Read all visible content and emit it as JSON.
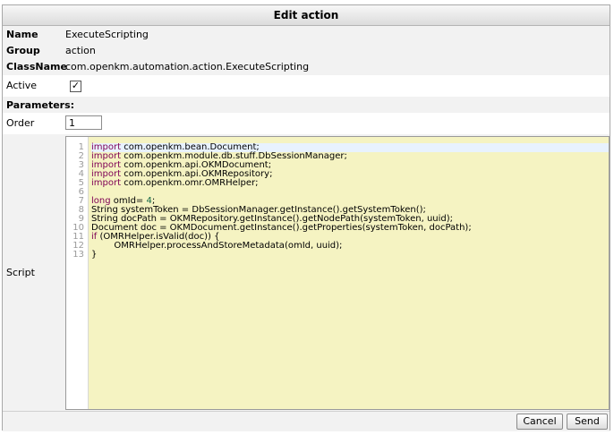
{
  "dialog": {
    "title": "Edit action"
  },
  "fields": {
    "name_label": "Name",
    "name_value": "ExecuteScripting",
    "group_label": "Group",
    "group_value": "action",
    "classname_label": "ClassName",
    "classname_value": "com.openkm.automation.action.ExecuteScripting",
    "active_label": "Active",
    "active_checked": true,
    "active_mark": "✓",
    "parameters_label": "Parameters:",
    "order_label": "Order",
    "order_value": "1",
    "script_label": "Script"
  },
  "script": {
    "line_numbers": [
      "1",
      "2",
      "3",
      "4",
      "5",
      "6",
      "7",
      "8",
      "9",
      "10",
      "11",
      "12",
      "13"
    ],
    "lines": [
      "import com.openkm.bean.Document;",
      "import com.openkm.module.db.stuff.DbSessionManager;",
      "import com.openkm.api.OKMDocument;",
      "import com.openkm.api.OKMRepository;",
      "import com.openkm.omr.OMRHelper;",
      "",
      "long omId= 4;",
      "String systemToken = DbSessionManager.getInstance().getSystemToken();",
      "String docPath = OKMRepository.getInstance().getNodePath(systemToken, uuid);",
      "Document doc = OKMDocument.getInstance().getProperties(systemToken, docPath);",
      "if (OMRHelper.isValid(doc)) {",
      "        OMRHelper.processAndStoreMetadata(omId, uuid);",
      "}"
    ]
  },
  "buttons": {
    "cancel": "Cancel",
    "send": "Send"
  }
}
